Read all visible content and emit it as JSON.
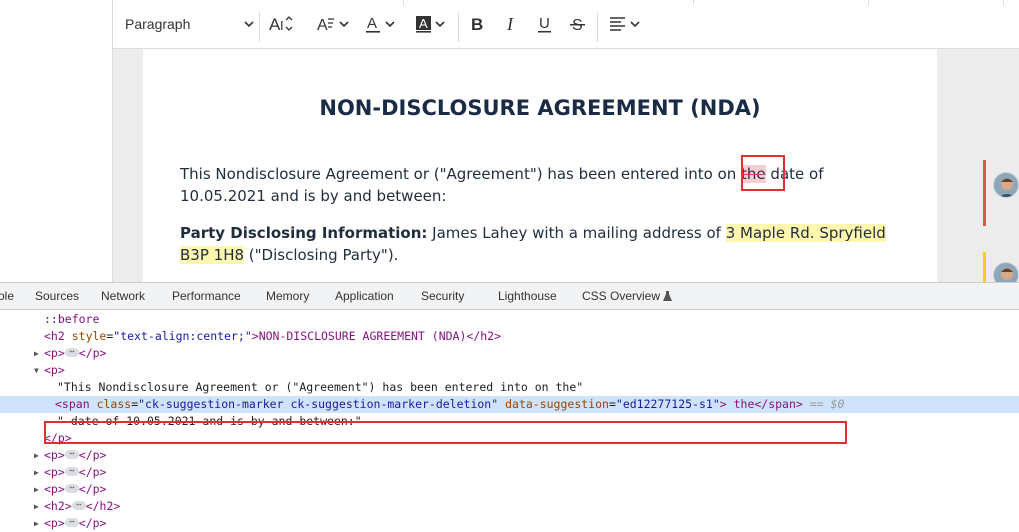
{
  "toolbar": {
    "paragraph_select": "Paragraph",
    "tools": [
      "font-size",
      "font-family",
      "font-color",
      "font-background-color",
      "bold",
      "italic",
      "underline",
      "strikethrough",
      "alignment"
    ]
  },
  "document": {
    "title": "NON-DISCLOSURE AGREEMENT (NDA)",
    "para1_before": "This Nondisclosure Agreement or (\"Agreement\") has been entered into on ",
    "para1_deleted": "the",
    "para1_after": " date of 10.05.2021 and is by and between:",
    "para2_label": "Party Disclosing Information:",
    "para2_text": " James Lahey with a mailing address of ",
    "para2_highlight": "3 Maple Rd. Spryfield B3P 1H8",
    "para2_end": "  (\"Disclosing Party\")."
  },
  "devtools": {
    "tabs": [
      "ole",
      "Sources",
      "Network",
      "Performance",
      "Memory",
      "Application",
      "Security",
      "Lighthouse",
      "CSS Overview"
    ],
    "dom": {
      "before": "::before",
      "h2_open": "<h2",
      "h2_attr": "style",
      "h2_val": "\"text-align:center;\"",
      "h2_text": ">NON-DISCLOSURE AGREEMENT (NDA)</h2>",
      "p_open": "<p>",
      "p_close": "</p>",
      "text1": "\"This Nondisclosure Agreement or (\"Agreement\") has been entered into on the\"",
      "span_open": "<span",
      "span_class_attr": "class",
      "span_class_val": "\"ck-suggestion-marker ck-suggestion-marker-deletion\"",
      "span_data_attr": "data-suggestion",
      "span_data_val": "\"ed12277125-s1\"",
      "span_text": "> the</span>",
      "dollar": "== $0",
      "text2": "\" date of 10.05.2021 and is by and between:\"",
      "h2_collapsed_open": "<h2>",
      "h2_collapsed_close": "</h2>"
    }
  },
  "colors": {
    "selection_box": "#e03131",
    "deletion": "#f7cdd3",
    "highlight": "#fff6b0",
    "accent_red": "#d9534f",
    "accent_yellow": "#f5d10a"
  }
}
